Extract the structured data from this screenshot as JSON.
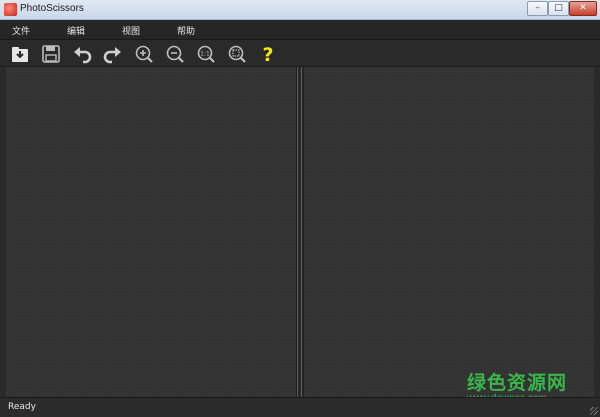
{
  "window": {
    "title": "PhotoScissors",
    "controls": {
      "minimize": "–",
      "maximize": "□",
      "close": "✕"
    }
  },
  "menu": {
    "items": [
      {
        "label": "文件"
      },
      {
        "label": "编辑"
      },
      {
        "label": "视图"
      },
      {
        "label": "帮助"
      }
    ]
  },
  "toolbar": {
    "buttons": [
      {
        "icon": "open-icon"
      },
      {
        "icon": "save-icon"
      },
      {
        "icon": "undo-icon"
      },
      {
        "icon": "redo-icon"
      },
      {
        "icon": "zoom-in-icon"
      },
      {
        "icon": "zoom-out-icon"
      },
      {
        "icon": "zoom-actual-size-icon",
        "label": "1:1"
      },
      {
        "icon": "zoom-fit-icon"
      },
      {
        "icon": "help-icon",
        "label": "?"
      }
    ],
    "icon_color": "#cfcfcf",
    "help_color": "#f5e617"
  },
  "status": {
    "text": "Ready"
  },
  "watermark": {
    "title": "绿色资源网",
    "url": "www.downcc.com"
  }
}
